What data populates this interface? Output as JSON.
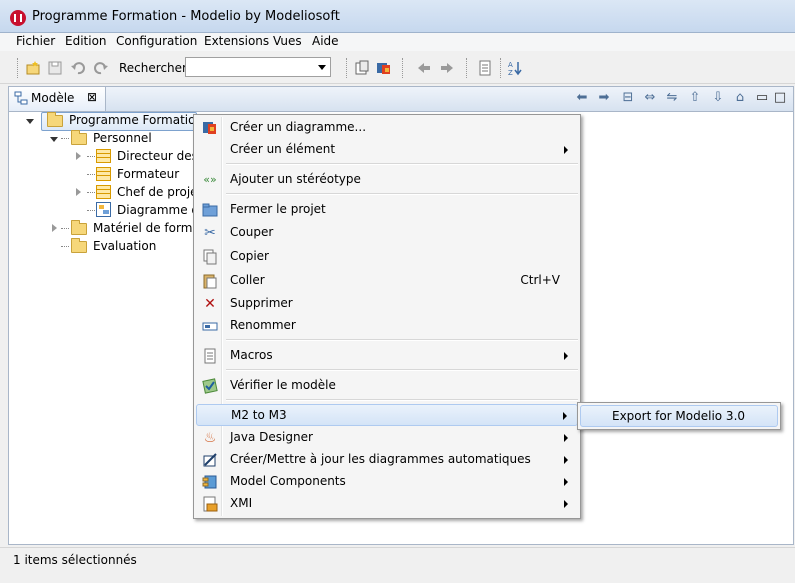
{
  "window": {
    "title": "Programme Formation - Modelio by Modeliosoft"
  },
  "menubar": {
    "items": [
      "Fichier",
      "Edition",
      "Configuration",
      "Extensions",
      "Vues",
      "Aide"
    ]
  },
  "toolbar": {
    "search_label": "Rechercher :",
    "search_value": ""
  },
  "view": {
    "tab_label": "Modèle",
    "tab_close": "⊠"
  },
  "tree": {
    "root": "Programme Formation",
    "personnel": "Personnel",
    "directeur": "Directeur des f",
    "formateur": "Formateur",
    "chef": "Chef de projet",
    "diagramme": "Diagramme de",
    "materiel": "Matériel de formati",
    "evaluation": "Evaluation"
  },
  "context_menu": {
    "creer_diagramme": "Créer un diagramme...",
    "creer_element": "Créer un élément",
    "ajouter_stereotype": "Ajouter un stéréotype",
    "fermer_projet": "Fermer le projet",
    "couper": "Couper",
    "copier": "Copier",
    "coller": "Coller",
    "coller_shortcut": "Ctrl+V",
    "supprimer": "Supprimer",
    "renommer": "Renommer",
    "macros": "Macros",
    "verifier": "Vérifier le modèle",
    "m2_to_m3": "M2 to M3",
    "java_designer": "Java Designer",
    "diagrammes_auto": "Créer/Mettre à jour les diagrammes automatiques",
    "model_components": "Model Components",
    "xmi": "XMI"
  },
  "submenu": {
    "export": "Export for Modelio 3.0"
  },
  "status": {
    "text": "1 items sélectionnés"
  },
  "colors": {
    "accent": "#3a6aa5",
    "folder": "#f6d77a",
    "highlight": "#d4e4f7"
  }
}
